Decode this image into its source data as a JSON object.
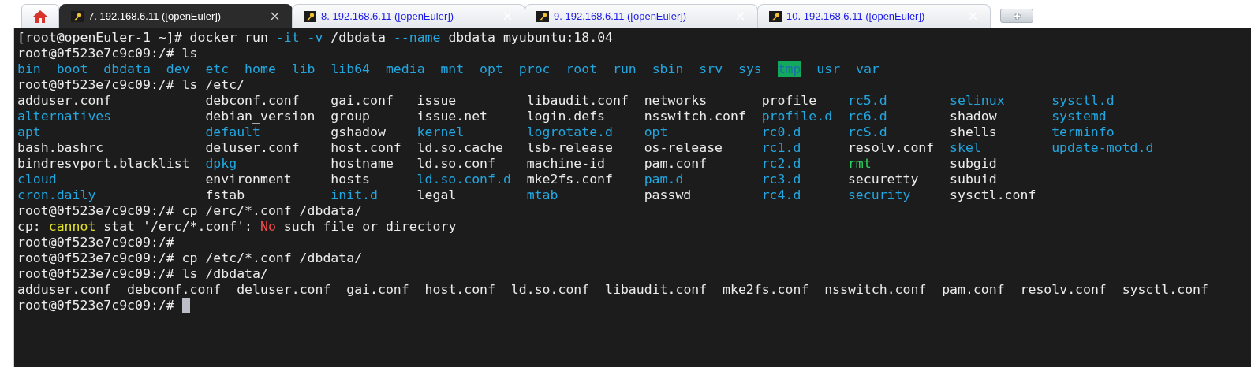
{
  "tabs": [
    {
      "kind": "home",
      "selected": false
    },
    {
      "kind": "session",
      "label": "7. 192.168.6.11 ([openEuler])",
      "selected": true
    },
    {
      "kind": "session",
      "label": "8. 192.168.6.11 ([openEuler])",
      "selected": false
    },
    {
      "kind": "session",
      "label": "9. 192.168.6.11 ([openEuler])",
      "selected": false
    },
    {
      "kind": "session",
      "label": "10. 192.168.6.11 ([openEuler])",
      "selected": false
    },
    {
      "kind": "new",
      "selected": false
    }
  ],
  "terminal": {
    "blocks": [
      {
        "kind": "line",
        "segments": [
          {
            "text": "[root@openEuler-1 ~]# docker run ",
            "kind": "plain"
          },
          {
            "text": "-it -v",
            "kind": "option"
          },
          {
            "text": " /dbdata ",
            "kind": "plain"
          },
          {
            "text": "--name",
            "kind": "option"
          },
          {
            "text": " dbdata myubuntu:18.04",
            "kind": "plain"
          }
        ]
      },
      {
        "kind": "line",
        "segments": [
          {
            "text": "root@0f523e7c9c09:/# ls",
            "kind": "plain"
          }
        ]
      },
      {
        "kind": "across",
        "items": [
          {
            "name": "bin",
            "kind": "dir"
          },
          {
            "name": "boot",
            "kind": "dir"
          },
          {
            "name": "dbdata",
            "kind": "dir"
          },
          {
            "name": "dev",
            "kind": "dir"
          },
          {
            "name": "etc",
            "kind": "dir"
          },
          {
            "name": "home",
            "kind": "dir"
          },
          {
            "name": "lib",
            "kind": "dir"
          },
          {
            "name": "lib64",
            "kind": "dir"
          },
          {
            "name": "media",
            "kind": "dir"
          },
          {
            "name": "mnt",
            "kind": "dir"
          },
          {
            "name": "opt",
            "kind": "dir"
          },
          {
            "name": "proc",
            "kind": "dir"
          },
          {
            "name": "root",
            "kind": "dir"
          },
          {
            "name": "run",
            "kind": "dir"
          },
          {
            "name": "sbin",
            "kind": "dir"
          },
          {
            "name": "srv",
            "kind": "dir"
          },
          {
            "name": "sys",
            "kind": "dir"
          },
          {
            "name": "tmp",
            "kind": "sticky"
          },
          {
            "name": "usr",
            "kind": "dir"
          },
          {
            "name": "var",
            "kind": "dir"
          }
        ]
      },
      {
        "kind": "line",
        "segments": [
          {
            "text": "root@0f523e7c9c09:/# ls /etc/",
            "kind": "plain"
          }
        ]
      },
      {
        "kind": "grid",
        "rows": [
          [
            {
              "name": "adduser.conf",
              "kind": "file"
            },
            {
              "name": "debconf.conf",
              "kind": "file"
            },
            {
              "name": "gai.conf",
              "kind": "file"
            },
            {
              "name": "issue",
              "kind": "file"
            },
            {
              "name": "libaudit.conf",
              "kind": "file"
            },
            {
              "name": "networks",
              "kind": "file"
            },
            {
              "name": "profile",
              "kind": "file"
            },
            {
              "name": "rc5.d",
              "kind": "dir"
            },
            {
              "name": "selinux",
              "kind": "dir"
            },
            {
              "name": "sysctl.d",
              "kind": "dir"
            }
          ],
          [
            {
              "name": "alternatives",
              "kind": "dir"
            },
            {
              "name": "debian_version",
              "kind": "file"
            },
            {
              "name": "group",
              "kind": "file"
            },
            {
              "name": "issue.net",
              "kind": "file"
            },
            {
              "name": "login.defs",
              "kind": "file"
            },
            {
              "name": "nsswitch.conf",
              "kind": "file"
            },
            {
              "name": "profile.d",
              "kind": "dir"
            },
            {
              "name": "rc6.d",
              "kind": "dir"
            },
            {
              "name": "shadow",
              "kind": "file"
            },
            {
              "name": "systemd",
              "kind": "dir"
            }
          ],
          [
            {
              "name": "apt",
              "kind": "dir"
            },
            {
              "name": "default",
              "kind": "dir"
            },
            {
              "name": "gshadow",
              "kind": "file"
            },
            {
              "name": "kernel",
              "kind": "dir"
            },
            {
              "name": "logrotate.d",
              "kind": "dir"
            },
            {
              "name": "opt",
              "kind": "dir"
            },
            {
              "name": "rc0.d",
              "kind": "dir"
            },
            {
              "name": "rcS.d",
              "kind": "dir"
            },
            {
              "name": "shells",
              "kind": "file"
            },
            {
              "name": "terminfo",
              "kind": "dir"
            }
          ],
          [
            {
              "name": "bash.bashrc",
              "kind": "file"
            },
            {
              "name": "deluser.conf",
              "kind": "file"
            },
            {
              "name": "host.conf",
              "kind": "file"
            },
            {
              "name": "ld.so.cache",
              "kind": "file"
            },
            {
              "name": "lsb-release",
              "kind": "file"
            },
            {
              "name": "os-release",
              "kind": "file"
            },
            {
              "name": "rc1.d",
              "kind": "dir"
            },
            {
              "name": "resolv.conf",
              "kind": "file"
            },
            {
              "name": "skel",
              "kind": "dir"
            },
            {
              "name": "update-motd.d",
              "kind": "dir"
            }
          ],
          [
            {
              "name": "bindresvport.blacklist",
              "kind": "file"
            },
            {
              "name": "dpkg",
              "kind": "dir"
            },
            {
              "name": "hostname",
              "kind": "file"
            },
            {
              "name": "ld.so.conf",
              "kind": "file"
            },
            {
              "name": "machine-id",
              "kind": "file"
            },
            {
              "name": "pam.conf",
              "kind": "file"
            },
            {
              "name": "rc2.d",
              "kind": "dir"
            },
            {
              "name": "rmt",
              "kind": "device"
            },
            {
              "name": "subgid",
              "kind": "file"
            }
          ],
          [
            {
              "name": "cloud",
              "kind": "dir"
            },
            {
              "name": "environment",
              "kind": "file"
            },
            {
              "name": "hosts",
              "kind": "file"
            },
            {
              "name": "ld.so.conf.d",
              "kind": "dir"
            },
            {
              "name": "mke2fs.conf",
              "kind": "file"
            },
            {
              "name": "pam.d",
              "kind": "dir"
            },
            {
              "name": "rc3.d",
              "kind": "dir"
            },
            {
              "name": "securetty",
              "kind": "file"
            },
            {
              "name": "subuid",
              "kind": "file"
            }
          ],
          [
            {
              "name": "cron.daily",
              "kind": "dir"
            },
            {
              "name": "fstab",
              "kind": "file"
            },
            {
              "name": "init.d",
              "kind": "dir"
            },
            {
              "name": "legal",
              "kind": "file"
            },
            {
              "name": "mtab",
              "kind": "dir"
            },
            {
              "name": "passwd",
              "kind": "file"
            },
            {
              "name": "rc4.d",
              "kind": "dir"
            },
            {
              "name": "security",
              "kind": "dir"
            },
            {
              "name": "sysctl.conf",
              "kind": "file"
            }
          ]
        ]
      },
      {
        "kind": "line",
        "segments": [
          {
            "text": "root@0f523e7c9c09:/# cp /erc/*.conf /dbdata/",
            "kind": "plain"
          }
        ]
      },
      {
        "kind": "line",
        "segments": [
          {
            "text": "cp: ",
            "kind": "plain"
          },
          {
            "text": "cannot",
            "kind": "warn"
          },
          {
            "text": " stat '/erc/*.conf': ",
            "kind": "plain"
          },
          {
            "text": "No",
            "kind": "error"
          },
          {
            "text": " such file or directory",
            "kind": "plain"
          }
        ]
      },
      {
        "kind": "line",
        "segments": [
          {
            "text": "root@0f523e7c9c09:/#",
            "kind": "plain"
          }
        ]
      },
      {
        "kind": "line",
        "segments": [
          {
            "text": "root@0f523e7c9c09:/# cp /etc/*.conf /dbdata/",
            "kind": "plain"
          }
        ]
      },
      {
        "kind": "line",
        "segments": [
          {
            "text": "root@0f523e7c9c09:/# ls /dbdata/",
            "kind": "plain"
          }
        ]
      },
      {
        "kind": "across",
        "items": [
          {
            "name": "adduser.conf",
            "kind": "file"
          },
          {
            "name": "debconf.conf",
            "kind": "file"
          },
          {
            "name": "deluser.conf",
            "kind": "file"
          },
          {
            "name": "gai.conf",
            "kind": "file"
          },
          {
            "name": "host.conf",
            "kind": "file"
          },
          {
            "name": "ld.so.conf",
            "kind": "file"
          },
          {
            "name": "libaudit.conf",
            "kind": "file"
          },
          {
            "name": "mke2fs.conf",
            "kind": "file"
          },
          {
            "name": "nsswitch.conf",
            "kind": "file"
          },
          {
            "name": "pam.conf",
            "kind": "file"
          },
          {
            "name": "resolv.conf",
            "kind": "file"
          },
          {
            "name": "sysctl.conf",
            "kind": "file"
          }
        ]
      },
      {
        "kind": "prompt",
        "segments": [
          {
            "text": "root@0f523e7c9c09:/#",
            "kind": "plain"
          }
        ]
      }
    ]
  }
}
